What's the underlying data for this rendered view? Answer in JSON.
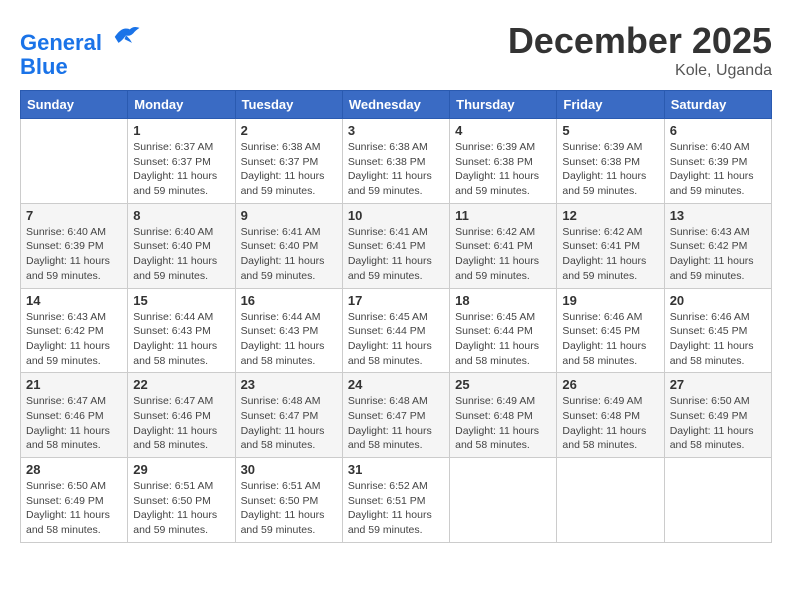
{
  "header": {
    "logo_line1": "General",
    "logo_line2": "Blue",
    "month_title": "December 2025",
    "location": "Kole, Uganda"
  },
  "weekdays": [
    "Sunday",
    "Monday",
    "Tuesday",
    "Wednesday",
    "Thursday",
    "Friday",
    "Saturday"
  ],
  "weeks": [
    [
      {
        "day": "",
        "sunrise": "",
        "sunset": "",
        "daylight": ""
      },
      {
        "day": "1",
        "sunrise": "Sunrise: 6:37 AM",
        "sunset": "Sunset: 6:37 PM",
        "daylight": "Daylight: 11 hours and 59 minutes."
      },
      {
        "day": "2",
        "sunrise": "Sunrise: 6:38 AM",
        "sunset": "Sunset: 6:37 PM",
        "daylight": "Daylight: 11 hours and 59 minutes."
      },
      {
        "day": "3",
        "sunrise": "Sunrise: 6:38 AM",
        "sunset": "Sunset: 6:38 PM",
        "daylight": "Daylight: 11 hours and 59 minutes."
      },
      {
        "day": "4",
        "sunrise": "Sunrise: 6:39 AM",
        "sunset": "Sunset: 6:38 PM",
        "daylight": "Daylight: 11 hours and 59 minutes."
      },
      {
        "day": "5",
        "sunrise": "Sunrise: 6:39 AM",
        "sunset": "Sunset: 6:38 PM",
        "daylight": "Daylight: 11 hours and 59 minutes."
      },
      {
        "day": "6",
        "sunrise": "Sunrise: 6:40 AM",
        "sunset": "Sunset: 6:39 PM",
        "daylight": "Daylight: 11 hours and 59 minutes."
      }
    ],
    [
      {
        "day": "7",
        "sunrise": "Sunrise: 6:40 AM",
        "sunset": "Sunset: 6:39 PM",
        "daylight": "Daylight: 11 hours and 59 minutes."
      },
      {
        "day": "8",
        "sunrise": "Sunrise: 6:40 AM",
        "sunset": "Sunset: 6:40 PM",
        "daylight": "Daylight: 11 hours and 59 minutes."
      },
      {
        "day": "9",
        "sunrise": "Sunrise: 6:41 AM",
        "sunset": "Sunset: 6:40 PM",
        "daylight": "Daylight: 11 hours and 59 minutes."
      },
      {
        "day": "10",
        "sunrise": "Sunrise: 6:41 AM",
        "sunset": "Sunset: 6:41 PM",
        "daylight": "Daylight: 11 hours and 59 minutes."
      },
      {
        "day": "11",
        "sunrise": "Sunrise: 6:42 AM",
        "sunset": "Sunset: 6:41 PM",
        "daylight": "Daylight: 11 hours and 59 minutes."
      },
      {
        "day": "12",
        "sunrise": "Sunrise: 6:42 AM",
        "sunset": "Sunset: 6:41 PM",
        "daylight": "Daylight: 11 hours and 59 minutes."
      },
      {
        "day": "13",
        "sunrise": "Sunrise: 6:43 AM",
        "sunset": "Sunset: 6:42 PM",
        "daylight": "Daylight: 11 hours and 59 minutes."
      }
    ],
    [
      {
        "day": "14",
        "sunrise": "Sunrise: 6:43 AM",
        "sunset": "Sunset: 6:42 PM",
        "daylight": "Daylight: 11 hours and 59 minutes."
      },
      {
        "day": "15",
        "sunrise": "Sunrise: 6:44 AM",
        "sunset": "Sunset: 6:43 PM",
        "daylight": "Daylight: 11 hours and 58 minutes."
      },
      {
        "day": "16",
        "sunrise": "Sunrise: 6:44 AM",
        "sunset": "Sunset: 6:43 PM",
        "daylight": "Daylight: 11 hours and 58 minutes."
      },
      {
        "day": "17",
        "sunrise": "Sunrise: 6:45 AM",
        "sunset": "Sunset: 6:44 PM",
        "daylight": "Daylight: 11 hours and 58 minutes."
      },
      {
        "day": "18",
        "sunrise": "Sunrise: 6:45 AM",
        "sunset": "Sunset: 6:44 PM",
        "daylight": "Daylight: 11 hours and 58 minutes."
      },
      {
        "day": "19",
        "sunrise": "Sunrise: 6:46 AM",
        "sunset": "Sunset: 6:45 PM",
        "daylight": "Daylight: 11 hours and 58 minutes."
      },
      {
        "day": "20",
        "sunrise": "Sunrise: 6:46 AM",
        "sunset": "Sunset: 6:45 PM",
        "daylight": "Daylight: 11 hours and 58 minutes."
      }
    ],
    [
      {
        "day": "21",
        "sunrise": "Sunrise: 6:47 AM",
        "sunset": "Sunset: 6:46 PM",
        "daylight": "Daylight: 11 hours and 58 minutes."
      },
      {
        "day": "22",
        "sunrise": "Sunrise: 6:47 AM",
        "sunset": "Sunset: 6:46 PM",
        "daylight": "Daylight: 11 hours and 58 minutes."
      },
      {
        "day": "23",
        "sunrise": "Sunrise: 6:48 AM",
        "sunset": "Sunset: 6:47 PM",
        "daylight": "Daylight: 11 hours and 58 minutes."
      },
      {
        "day": "24",
        "sunrise": "Sunrise: 6:48 AM",
        "sunset": "Sunset: 6:47 PM",
        "daylight": "Daylight: 11 hours and 58 minutes."
      },
      {
        "day": "25",
        "sunrise": "Sunrise: 6:49 AM",
        "sunset": "Sunset: 6:48 PM",
        "daylight": "Daylight: 11 hours and 58 minutes."
      },
      {
        "day": "26",
        "sunrise": "Sunrise: 6:49 AM",
        "sunset": "Sunset: 6:48 PM",
        "daylight": "Daylight: 11 hours and 58 minutes."
      },
      {
        "day": "27",
        "sunrise": "Sunrise: 6:50 AM",
        "sunset": "Sunset: 6:49 PM",
        "daylight": "Daylight: 11 hours and 58 minutes."
      }
    ],
    [
      {
        "day": "28",
        "sunrise": "Sunrise: 6:50 AM",
        "sunset": "Sunset: 6:49 PM",
        "daylight": "Daylight: 11 hours and 58 minutes."
      },
      {
        "day": "29",
        "sunrise": "Sunrise: 6:51 AM",
        "sunset": "Sunset: 6:50 PM",
        "daylight": "Daylight: 11 hours and 59 minutes."
      },
      {
        "day": "30",
        "sunrise": "Sunrise: 6:51 AM",
        "sunset": "Sunset: 6:50 PM",
        "daylight": "Daylight: 11 hours and 59 minutes."
      },
      {
        "day": "31",
        "sunrise": "Sunrise: 6:52 AM",
        "sunset": "Sunset: 6:51 PM",
        "daylight": "Daylight: 11 hours and 59 minutes."
      },
      {
        "day": "",
        "sunrise": "",
        "sunset": "",
        "daylight": ""
      },
      {
        "day": "",
        "sunrise": "",
        "sunset": "",
        "daylight": ""
      },
      {
        "day": "",
        "sunrise": "",
        "sunset": "",
        "daylight": ""
      }
    ]
  ]
}
